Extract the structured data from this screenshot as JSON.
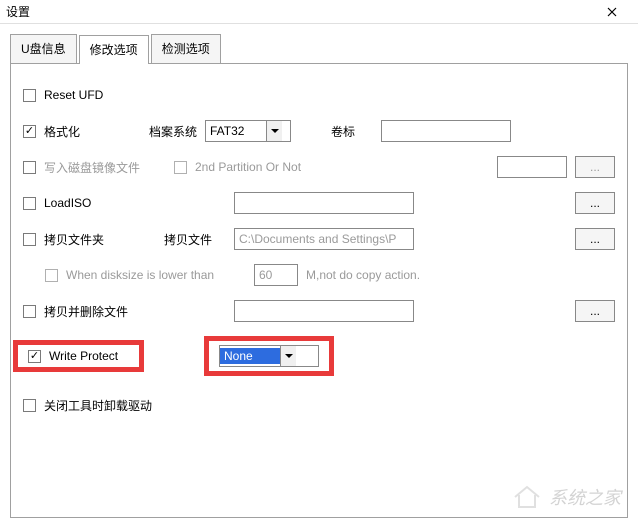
{
  "window": {
    "title": "设置"
  },
  "tabs": {
    "items": [
      "U盘信息",
      "修改选项",
      "检测选项"
    ],
    "active_index": 1
  },
  "rows": {
    "reset_ufd": {
      "label": "Reset UFD",
      "checked": false
    },
    "format": {
      "label": "格式化",
      "checked": true,
      "fs_label": "档案系统",
      "fs_value": "FAT32",
      "vol_label": "卷标",
      "vol_value": ""
    },
    "write_image": {
      "label": "写入磁盘镜像文件",
      "checked": false,
      "second_partition_label": "2nd Partition Or Not",
      "second_partition_checked": false,
      "path": "",
      "browse": "..."
    },
    "load_iso": {
      "label": "LoadISO",
      "checked": false,
      "path": "",
      "browse": "..."
    },
    "copy_folder": {
      "label": "拷贝文件夹",
      "checked": false,
      "copy_file_label": "拷贝文件",
      "path": "C:\\Documents and Settings\\P",
      "browse": "..."
    },
    "disksize": {
      "label": "When disksize is lower than",
      "checked": false,
      "value": "60",
      "suffix": "M,not do copy action."
    },
    "copy_delete": {
      "label": "拷贝并删除文件",
      "checked": false,
      "path": "",
      "browse": "..."
    },
    "write_protect": {
      "label": "Write Protect",
      "checked": true,
      "value": "None"
    },
    "close_tool": {
      "label": "关闭工具时卸载驱动",
      "checked": false
    }
  },
  "watermark": "系统之家"
}
